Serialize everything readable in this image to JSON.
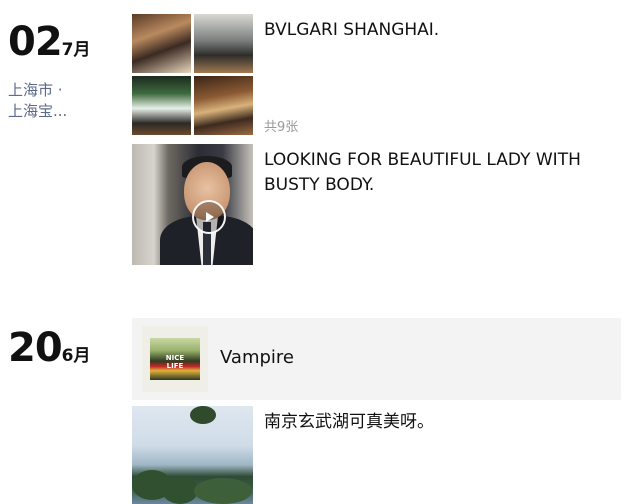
{
  "posts": [
    {
      "date": {
        "day": "02",
        "month": "7月"
      },
      "location": [
        "上海市 ·",
        "上海宝..."
      ],
      "entries": [
        {
          "type": "photos",
          "text": "BVLGARI  SHANGHAI.",
          "count": "共9张"
        },
        {
          "type": "video",
          "text": "LOOKING FOR BEAUTIFUL LADY WITH BUSTY BODY."
        }
      ]
    },
    {
      "date": {
        "day": "20",
        "month": "6月"
      },
      "entries": [
        {
          "type": "music",
          "title": "Vampire",
          "album_text": "NICE LIFE"
        },
        {
          "type": "photo",
          "text": "南京玄武湖可真美呀。"
        }
      ]
    }
  ],
  "icons": {
    "play": "play-icon"
  },
  "colors": {
    "location": "#5b6a8a",
    "count": "#9a9a9a",
    "music_card_bg": "#f3f3f3"
  }
}
